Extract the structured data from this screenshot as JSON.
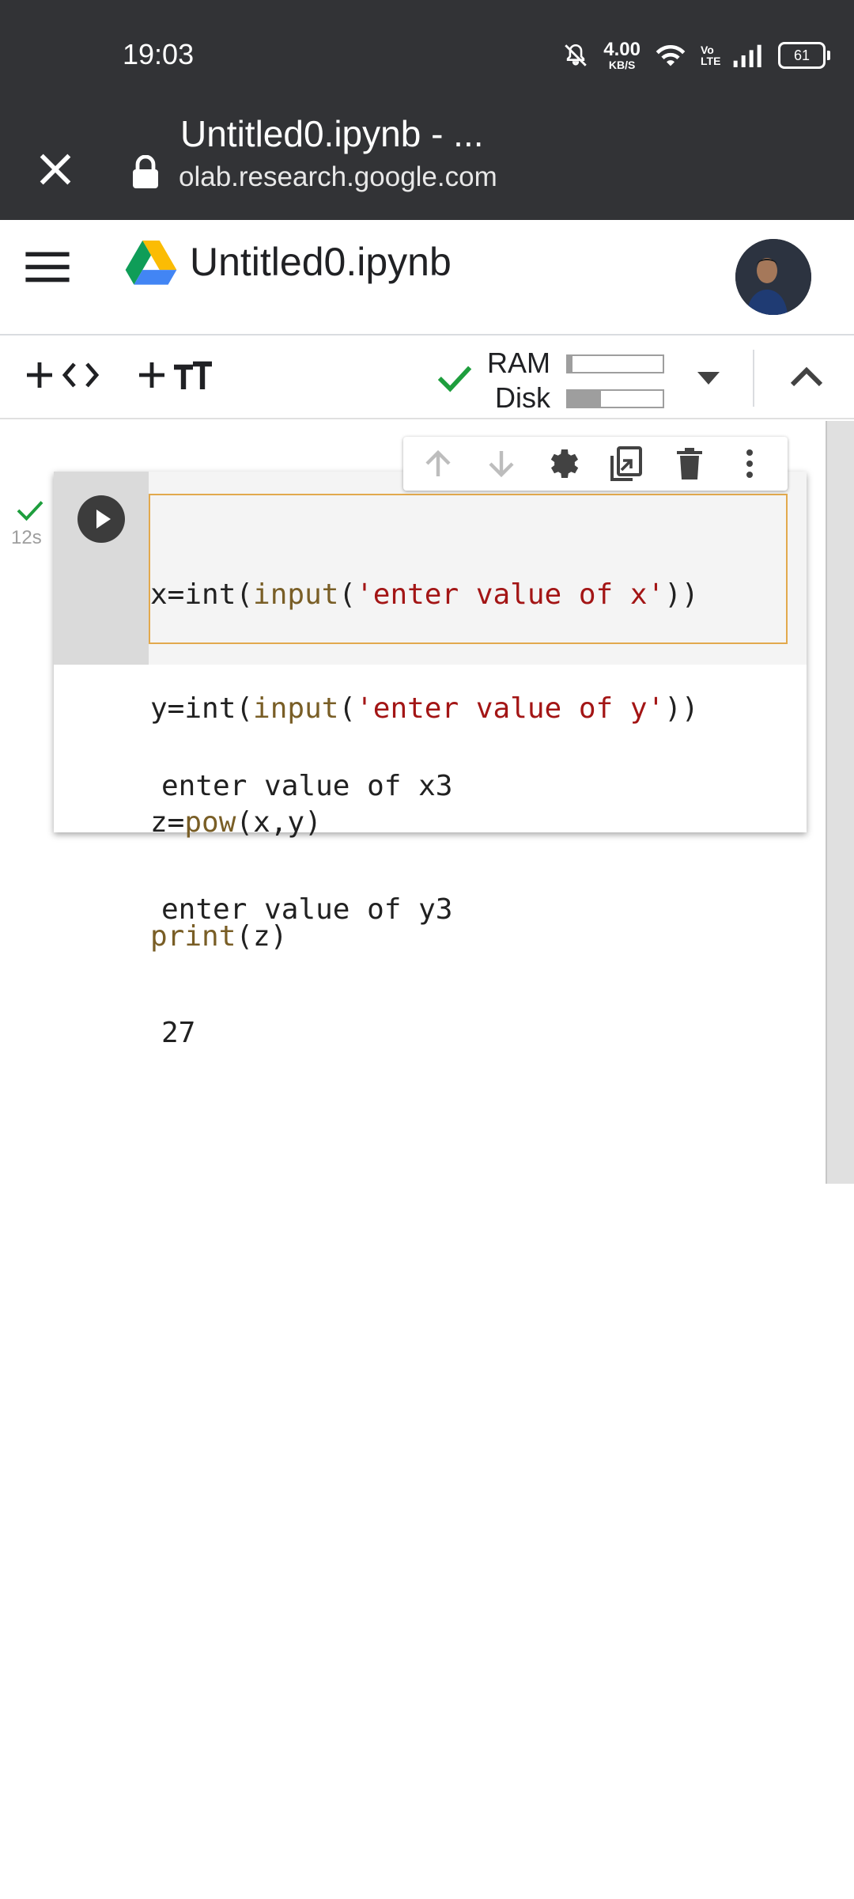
{
  "status_bar": {
    "time": "19:03",
    "net_speed_value": "4.00",
    "net_speed_unit": "KB/S",
    "network_label": "Vo LTE",
    "battery": "61"
  },
  "browser": {
    "tab_title": "Untitled0.ipynb - ...",
    "domain": "olab.research.google.com"
  },
  "notebook": {
    "title": "Untitled0.ipynb"
  },
  "toolbar": {
    "add_code_label": "+ <>",
    "add_text_label": "+",
    "ram_label": "RAM",
    "disk_label": "Disk",
    "ram_usage": 0.05,
    "disk_usage": 0.35
  },
  "cell": {
    "exec_time": "12s",
    "code_lines": [
      "x=int(input('enter value of x'))",
      "y=int(input('enter value of y'))",
      "z=pow(x,y)",
      "print(z)"
    ],
    "output_lines": [
      "enter value of x3",
      "enter value of y3",
      "27"
    ]
  },
  "colors": {
    "chrome_bg": "#323336",
    "accent_green": "#1e9e3d",
    "editor_border": "#e2a94d",
    "string_red": "#a31515",
    "builtin_brown": "#795e26"
  },
  "icons": {
    "browser": [
      "close-icon",
      "lock-icon",
      "bookmark-icon",
      "share-icon",
      "more-vert-icon"
    ],
    "appbar": [
      "menu-icon",
      "google-drive-icon",
      "avatar"
    ],
    "cell_toolbar": [
      "arrow-up-icon",
      "arrow-down-icon",
      "gear-icon",
      "mirror-cell-icon",
      "delete-icon",
      "more-vert-icon"
    ]
  }
}
